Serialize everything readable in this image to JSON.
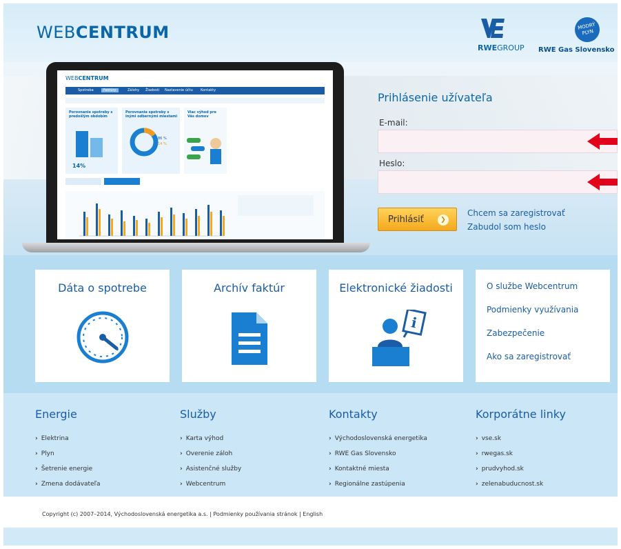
{
  "header": {
    "brand_light": "WEB",
    "brand_bold": "CENTRUM",
    "rwe_group_bold": "RWE",
    "rwe_group_light": "GROUP",
    "gas_badge_line1": "MODRÝ",
    "gas_badge_line2": "PLYN",
    "gas_name": "RWE Gas Slovensko"
  },
  "laptop_screen": {
    "brand_light": "WEB",
    "brand_bold": "CENTRUM",
    "nav": [
      "Spotreba",
      "Faktúry",
      "Zálohy",
      "Žiadosti",
      "Nastavenie účtu",
      "Kontakty"
    ],
    "card1_title": "Porovnanie spotreby s predošlým obdobím",
    "card2_title": "Porovnanie spotreby s inými odbernými miestami",
    "card3_title": "Viac výhod pre Vás domov",
    "percent": "14%",
    "donut_a": "86 %",
    "donut_b": "14 %"
  },
  "login": {
    "title": "Prihlásenie užívateľa",
    "email_label": "E-mail:",
    "password_label": "Heslo:",
    "email_value": "",
    "password_value": "",
    "submit_label": "Prihlásiť",
    "register_link": "Chcem sa zaregistrovať",
    "forgot_link": "Zabudol som heslo"
  },
  "tiles": [
    {
      "title": "Dáta o spotrebe",
      "icon": "gauge-icon"
    },
    {
      "title": "Archív faktúr",
      "icon": "document-icon"
    },
    {
      "title": "Elektronické žiadosti",
      "icon": "person-sign-icon"
    }
  ],
  "info_links": [
    "O službe Webcentrum",
    "Podmienky využívania",
    "Zabezpečenie",
    "Ako sa zaregistrovať"
  ],
  "footer_columns": [
    {
      "heading": "Energie",
      "items": [
        "Elektrina",
        "Plyn",
        "Šetrenie energie",
        "Zmena dodávateľa"
      ]
    },
    {
      "heading": "Služby",
      "items": [
        "Karta výhod",
        "Overenie záloh",
        "Asistenčné služby",
        "Webcentrum"
      ]
    },
    {
      "heading": "Kontakty",
      "items": [
        "Východoslovenská energetika",
        "RWE Gas Slovensko",
        "Kontaktné miesta",
        "Regionálne zastúpenia"
      ]
    },
    {
      "heading": "Korporátne linky",
      "items": [
        "vse.sk",
        "rwegas.sk",
        "prudvyhod.sk",
        "zelenabuducnost.sk"
      ]
    }
  ],
  "copyright": {
    "text": "Copyright (c) 2007–2014, Východoslovenská energetika a.s.",
    "sep": "|",
    "terms": "Podmienky používania stránok",
    "english": "English"
  },
  "colors": {
    "brand_blue": "#0a66a8",
    "arrow_red": "#e2001a",
    "button_orange": "#f4a81d",
    "band_blue": "#b6dcf2"
  }
}
